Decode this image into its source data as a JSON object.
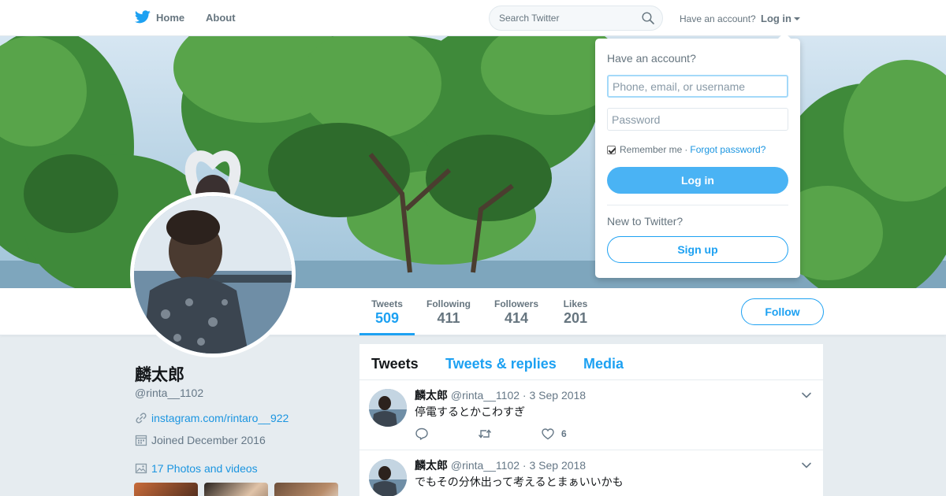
{
  "topnav": {
    "home_label": "Home",
    "about_label": "About",
    "search_placeholder": "Search Twitter",
    "account_question": "Have an account?",
    "login_label": "Log in"
  },
  "profile": {
    "name": "麟太郎",
    "handle": "@rinta__1102",
    "website": "instagram.com/rintaro__922",
    "joined": "Joined December 2016",
    "photos_link": "17 Photos and videos"
  },
  "stats": [
    {
      "label": "Tweets",
      "value": "509",
      "active": true
    },
    {
      "label": "Following",
      "value": "411",
      "active": false
    },
    {
      "label": "Followers",
      "value": "414",
      "active": false
    },
    {
      "label": "Likes",
      "value": "201",
      "active": false
    }
  ],
  "follow_label": "Follow",
  "timeline": {
    "tabs": [
      "Tweets",
      "Tweets & replies",
      "Media"
    ],
    "tweets": [
      {
        "name": "麟太郎",
        "handle": "@rinta__1102",
        "date": "3 Sep 2018",
        "text": "停電するとかこわすぎ",
        "likes": "6"
      },
      {
        "name": "麟太郎",
        "handle": "@rinta__1102",
        "date": "3 Sep 2018",
        "text": "でもその分休出って考えるとまぁいいかも",
        "likes": ""
      }
    ]
  },
  "login_dropdown": {
    "title": "Have an account?",
    "username_placeholder": "Phone, email, or username",
    "password_placeholder": "Password",
    "remember_label": "Remember me",
    "separator": "·",
    "forgot_label": "Forgot password?",
    "login_button": "Log in",
    "new_label": "New to Twitter?",
    "signup_button": "Sign up"
  },
  "colors": {
    "accent": "#1da1f2",
    "login_button_bg": "#4ab3f4",
    "page_bg": "#e6ecf0",
    "muted_text": "#657786"
  }
}
